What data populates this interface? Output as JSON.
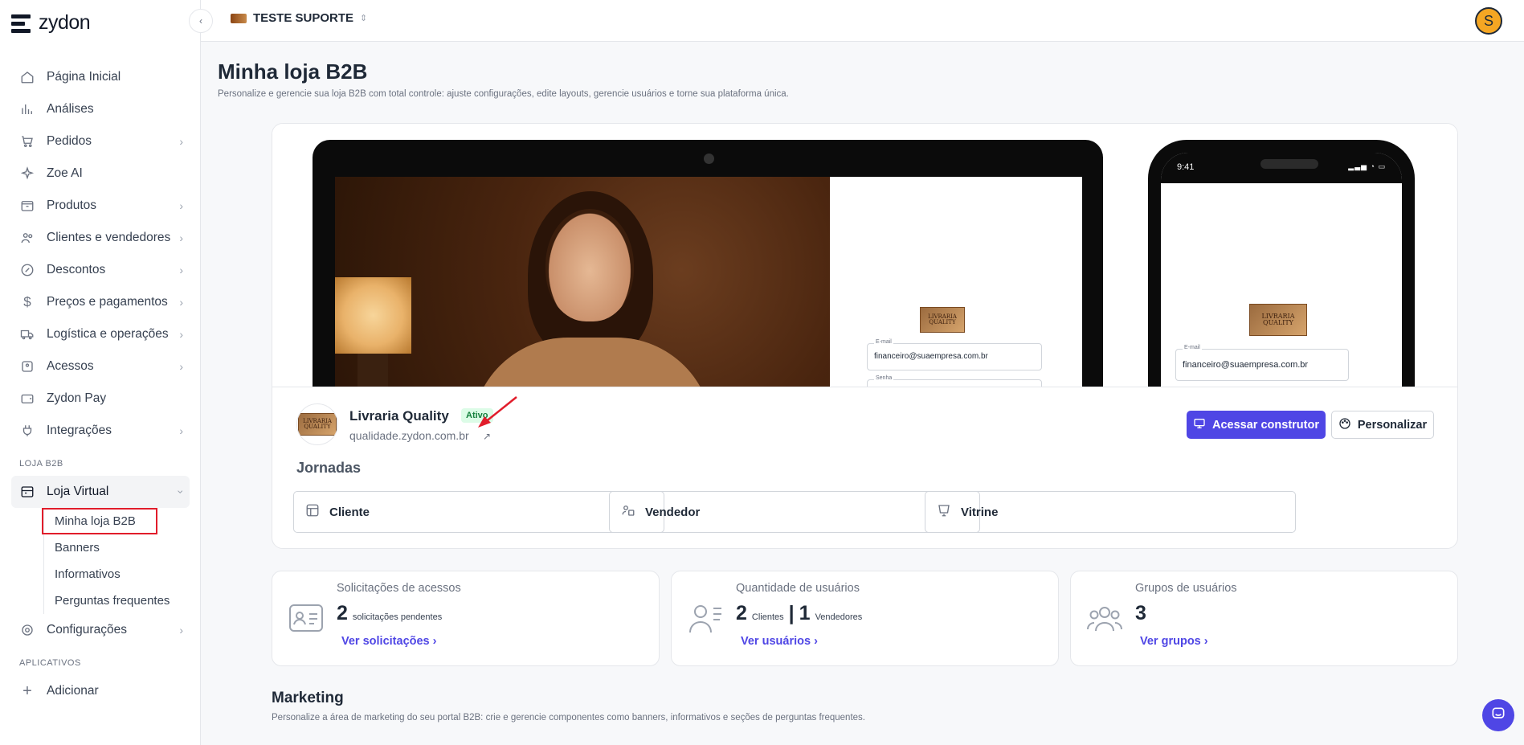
{
  "brand": {
    "name": "zydon"
  },
  "topbar": {
    "store_name": "TESTE SUPORTE",
    "user_initial": "S"
  },
  "sidebar": {
    "items": [
      {
        "label": "Página Inicial",
        "icon": "home-icon",
        "chevron": false
      },
      {
        "label": "Análises",
        "icon": "chart-icon",
        "chevron": false
      },
      {
        "label": "Pedidos",
        "icon": "cart-icon",
        "chevron": true
      },
      {
        "label": "Zoe AI",
        "icon": "sparkle-icon",
        "chevron": false
      },
      {
        "label": "Produtos",
        "icon": "box-icon",
        "chevron": true
      },
      {
        "label": "Clientes e vendedores",
        "icon": "users-icon",
        "chevron": true
      },
      {
        "label": "Descontos",
        "icon": "discount-icon",
        "chevron": true
      },
      {
        "label": "Preços e pagamentos",
        "icon": "dollar-icon",
        "chevron": true
      },
      {
        "label": "Logística e operações",
        "icon": "truck-icon",
        "chevron": true
      },
      {
        "label": "Acessos",
        "icon": "access-icon",
        "chevron": true
      },
      {
        "label": "Zydon Pay",
        "icon": "wallet-icon",
        "chevron": false
      },
      {
        "label": "Integrações",
        "icon": "plug-icon",
        "chevron": true
      }
    ],
    "section_b2b": "LOJA B2B",
    "loja_virtual": "Loja Virtual",
    "sub_items": [
      "Minha loja B2B",
      "Banners",
      "Informativos",
      "Perguntas frequentes"
    ],
    "config": "Configurações",
    "section_apps": "APLICATIVOS",
    "add": "Adicionar"
  },
  "page": {
    "title": "Minha loja B2B",
    "subtitle": "Personalize e gerencie sua loja B2B com total controle: ajuste configurações, edite layouts, gerencie usuários e torne sua plataforma única."
  },
  "preview": {
    "email_label": "E-mail",
    "email_value": "financeiro@suaempresa.com.br",
    "password_label": "Senha",
    "phone_time": "9:41",
    "logo_text": "LIVRARIA QUALITY"
  },
  "store": {
    "name": "Livraria Quality",
    "status": "Ativo",
    "url": "qualidade.zydon.com.br",
    "btn_builder": "Acessar construtor",
    "btn_customize": "Personalizar"
  },
  "journeys": {
    "title": "Jornadas",
    "items": [
      "Cliente",
      "Vendedor",
      "Vitrine"
    ]
  },
  "stats": [
    {
      "title": "Solicitações de acessos",
      "value": "2",
      "value_label": "solicitações pendentes",
      "link": "Ver solicitações"
    },
    {
      "title": "Quantidade de usuários",
      "value": "2",
      "value_label": "Clientes",
      "separator": "|",
      "value2": "1",
      "value2_label": "Vendedores",
      "link": "Ver usuários"
    },
    {
      "title": "Grupos de usuários",
      "value": "3",
      "link": "Ver grupos"
    }
  ],
  "marketing": {
    "title": "Marketing",
    "subtitle": "Personalize a área de marketing do seu portal B2B: crie e gerencie componentes como banners, informativos e seções de perguntas frequentes."
  },
  "colors": {
    "accent": "#4f46e5",
    "active_badge": "#15803d",
    "highlight": "#e11d2b"
  }
}
